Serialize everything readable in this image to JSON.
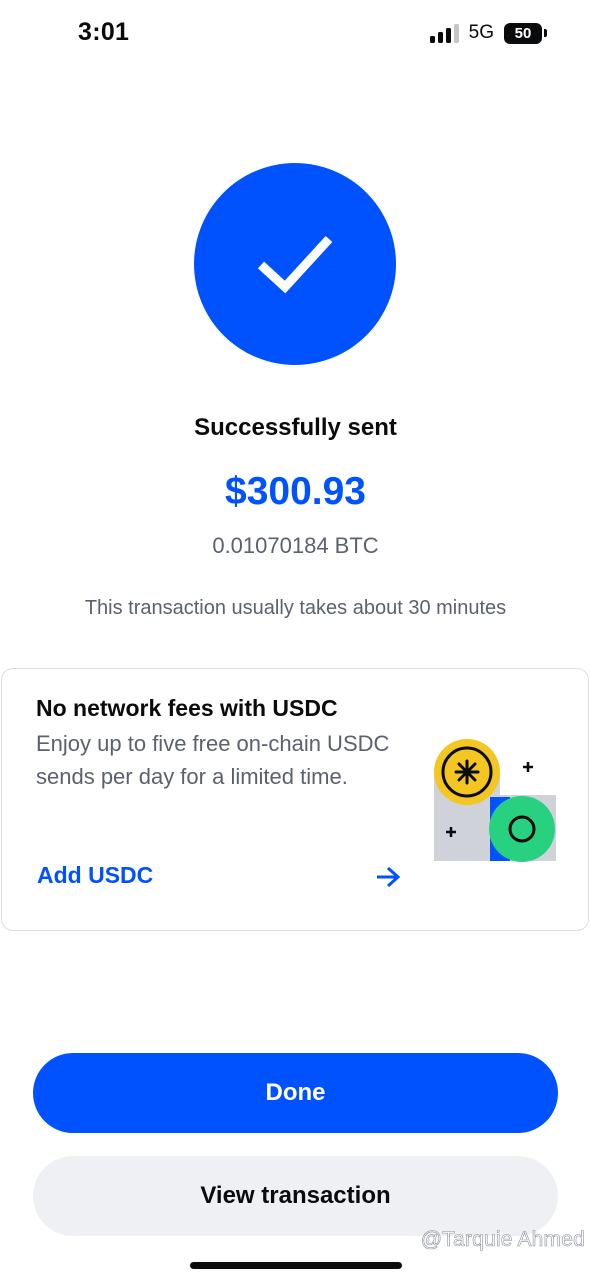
{
  "status_bar": {
    "time": "3:01",
    "network": "5G",
    "battery": "50"
  },
  "success": {
    "icon": "checkmark-icon",
    "headline": "Successfully sent",
    "amount_fiat": "$300.93",
    "amount_crypto": "0.01070184 BTC",
    "eta_note": "This transaction usually takes about 30 minutes"
  },
  "promo": {
    "title": "No network fees with USDC",
    "body": "Enjoy up to five free on-chain USDC sends per day for a limited time.",
    "link_label": "Add USDC",
    "arrow_icon": "arrow-right-icon",
    "illustration_icon": "usdc-coins-illustration"
  },
  "buttons": {
    "done_label": "Done",
    "view_label": "View transaction"
  },
  "watermark": "@Tarquie Ahmed",
  "colors": {
    "brand_blue": "#0052ff",
    "secondary_button_bg": "#eef0f3",
    "muted_text": "#5b616e",
    "coin_yellow": "#f4c622",
    "coin_green": "#27d17f"
  }
}
